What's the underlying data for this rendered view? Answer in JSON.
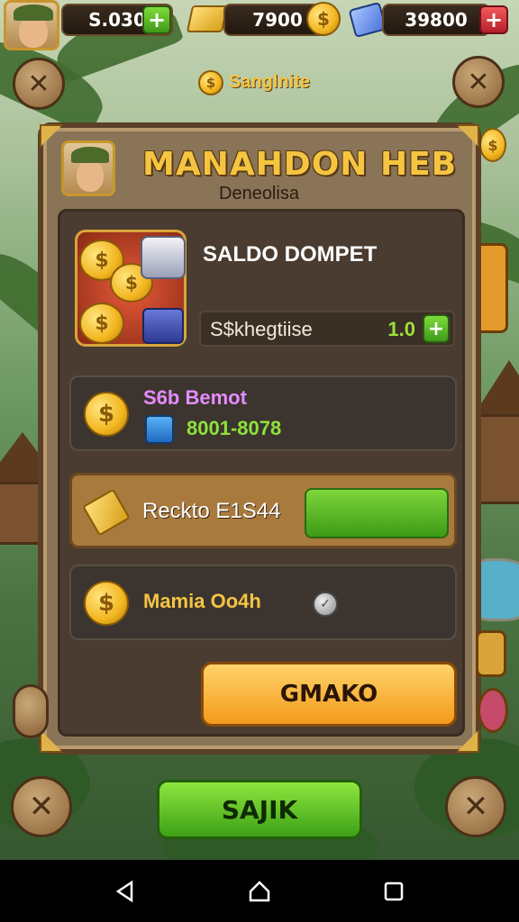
{
  "topbar": {
    "money": "S.030",
    "gold": "7900",
    "gems": "39800"
  },
  "daily": {
    "label": "Sanglnite"
  },
  "modal": {
    "title": "MANAHDON HEB",
    "subtitle": "Deneolisa",
    "wallet": {
      "title": "SALDO DOMPET",
      "field_label": "S$khegtiise",
      "field_value": "1.0"
    },
    "deposit": {
      "label": "S6b Bemot",
      "value": "8001-8078"
    },
    "recheck": {
      "label": "Reckto E1S44"
    },
    "claim": {
      "label": "Mamia Oo4h"
    },
    "primary_button": "GMAKO"
  },
  "footer_button": "SAJIK",
  "icons": {
    "plus": "+",
    "close": "✕",
    "coin": "$"
  },
  "colors": {
    "gold_text": "#f5c542",
    "green_value": "#9ee13a",
    "purple_label": "#e58cff",
    "modal_bg": "#8a7458"
  }
}
